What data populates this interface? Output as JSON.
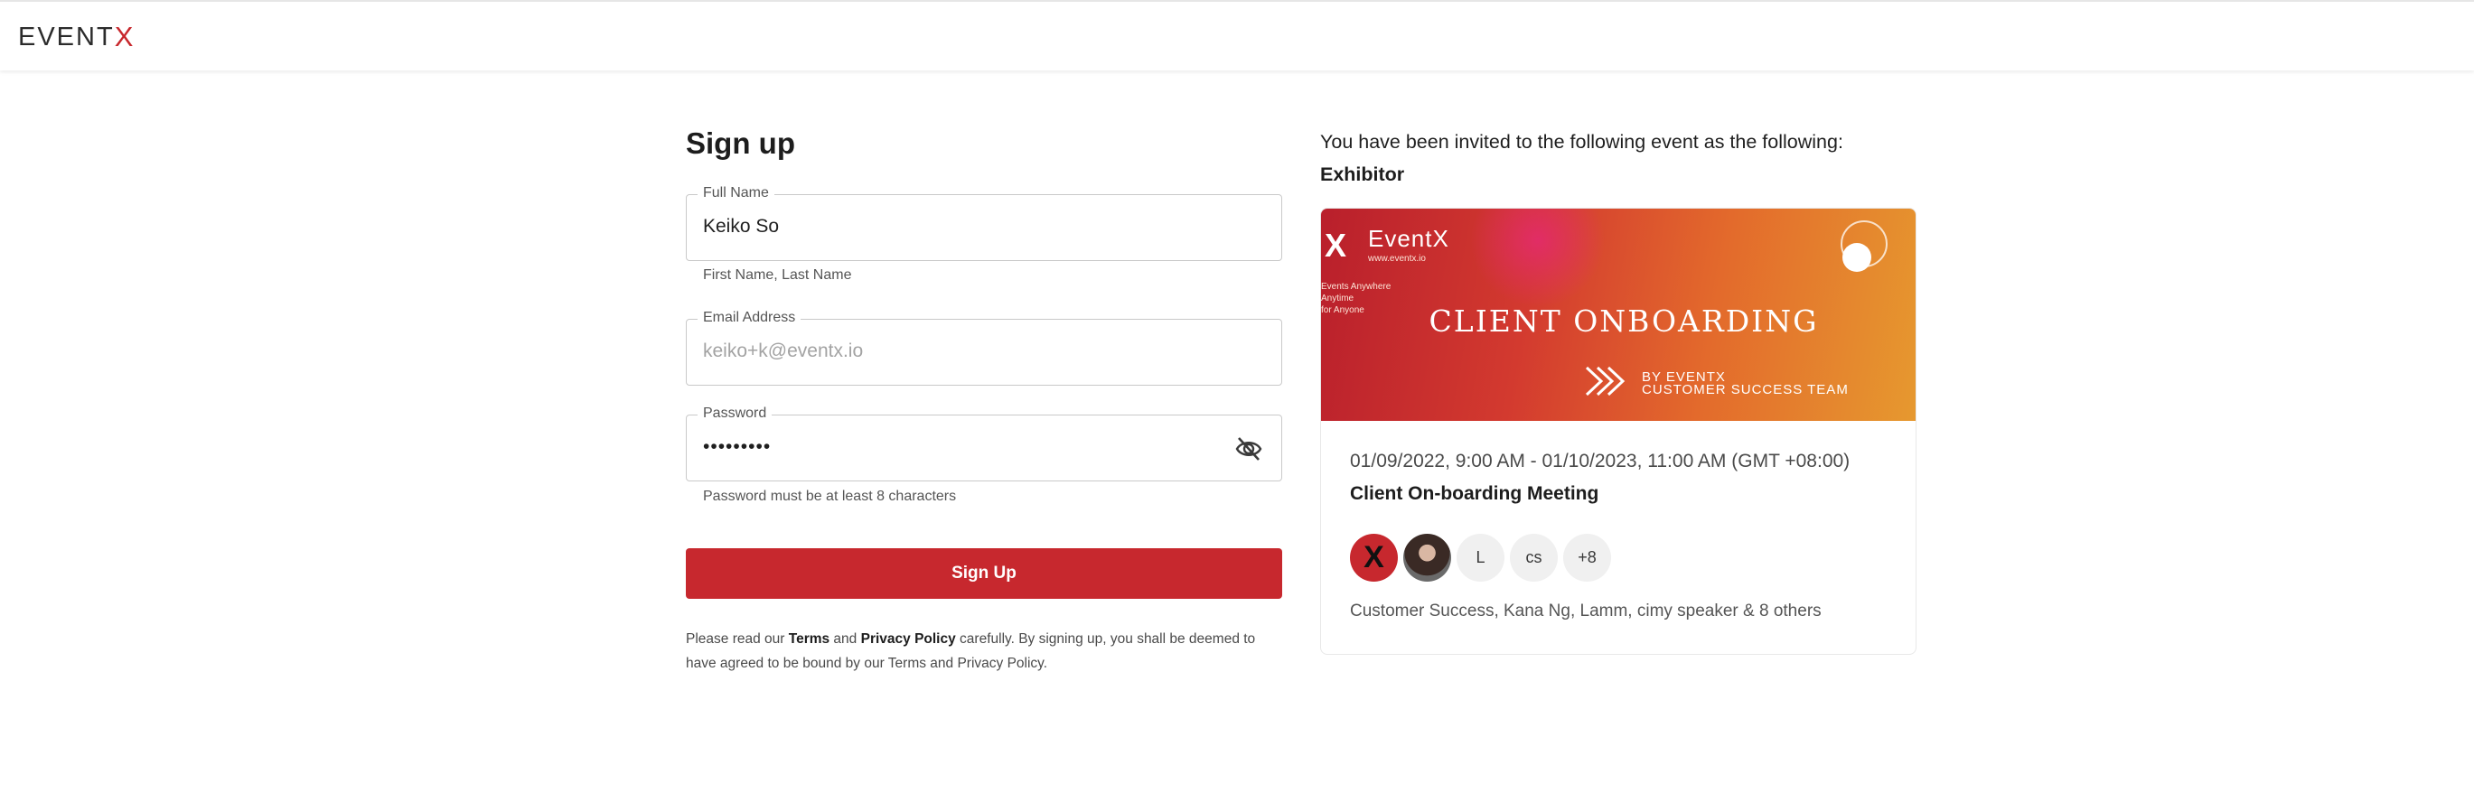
{
  "header": {
    "logo_main": "EVENT",
    "logo_x": "X"
  },
  "form": {
    "title": "Sign up",
    "full_name": {
      "label": "Full Name",
      "value": "Keiko So",
      "helper": "First Name, Last Name"
    },
    "email": {
      "label": "Email Address",
      "placeholder": "keiko+k@eventx.io"
    },
    "password": {
      "label": "Password",
      "value": "•••••••••",
      "helper": "Password must be at least 8 characters"
    },
    "submit_label": "Sign Up",
    "legal": {
      "prefix": "Please read our ",
      "terms": "Terms",
      "and": " and ",
      "privacy": "Privacy Policy",
      "suffix": " carefully. By signing up, you shall be deemed to have agreed to be bound by our Terms and Privacy Policy."
    }
  },
  "invite": {
    "text": "You have been invited to the following event as the following:",
    "role": "Exhibitor"
  },
  "event": {
    "banner": {
      "logo_mark": "X",
      "logo_text": "EventX",
      "url": "www.eventx.io",
      "tagline_1": "Events Anywhere",
      "tagline_2": "Anytime",
      "tagline_3": "for Anyone",
      "title": "CLIENT ONBOARDING",
      "by_1": "BY EVENTX",
      "by_2": "CUSTOMER SUCCESS TEAM"
    },
    "date": "01/09/2022, 9:00 AM - 01/10/2023, 11:00 AM (GMT +08:00)",
    "name": "Client On-boarding Meeting",
    "avatars": {
      "a1": "X",
      "a3": "L",
      "a4": "cs",
      "more": "+8"
    },
    "people": "Customer Success, Kana Ng, Lamm, cimy speaker & 8 others"
  },
  "colors": {
    "brand_red": "#c7282e"
  },
  "icons": {
    "password_toggle": "eye-off-icon"
  }
}
